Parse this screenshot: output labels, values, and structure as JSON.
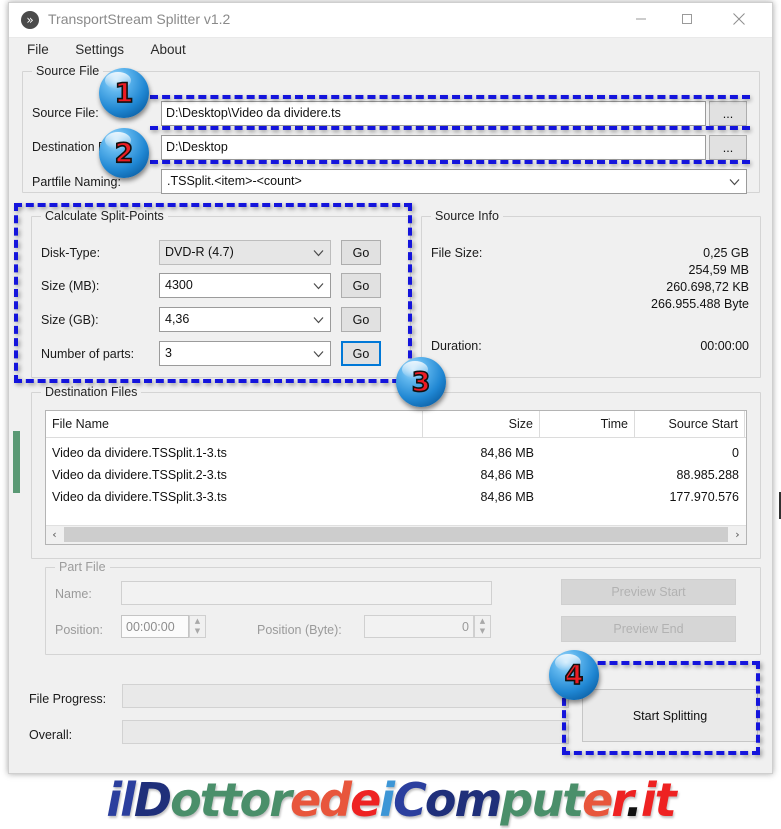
{
  "window": {
    "title": "TransportStream Splitter v1.2",
    "icon": "chevrons-icon",
    "minimize": "minimize-icon",
    "maximize": "maximize-icon",
    "close": "close-icon"
  },
  "menu": {
    "items": [
      "File",
      "Settings",
      "About"
    ]
  },
  "source_file_group": {
    "legend": "Source File",
    "source_file_label": "Source File:",
    "source_file_value": "D:\\Desktop\\Video da dividere.ts",
    "destination_folder_label": "Destination Folder:",
    "destination_folder_value": "D:\\Desktop",
    "partfile_naming_label": "Partfile Naming:",
    "partfile_naming_value": ".TSSplit.<item>-<count>",
    "browse_label": "..."
  },
  "split_points_group": {
    "legend": "Calculate Split-Points",
    "go_label": "Go",
    "rows": [
      {
        "label": "Disk-Type:",
        "value": "DVD-R (4.7)"
      },
      {
        "label": "Size (MB):",
        "value": "4300"
      },
      {
        "label": "Size (GB):",
        "value": "4,36"
      },
      {
        "label": "Number of parts:",
        "value": "3"
      }
    ]
  },
  "source_info_group": {
    "legend": "Source Info",
    "file_size_label": "File Size:",
    "file_size_values": [
      "0,25 GB",
      "254,59 MB",
      "260.698,72 KB",
      "266.955.488 Byte"
    ],
    "duration_label": "Duration:",
    "duration_value": "00:00:00"
  },
  "destination_files_group": {
    "legend": "Destination Files",
    "columns": [
      "File Name",
      "Size",
      "Time",
      "Source Start"
    ],
    "rows": [
      {
        "name": "Video da dividere.TSSplit.1-3.ts",
        "size": "84,86 MB",
        "time": "",
        "source_start": "0"
      },
      {
        "name": "Video da dividere.TSSplit.2-3.ts",
        "size": "84,86 MB",
        "time": "",
        "source_start": "88.985.288"
      },
      {
        "name": "Video da dividere.TSSplit.3-3.ts",
        "size": "84,86 MB",
        "time": "",
        "source_start": "177.970.576"
      }
    ],
    "scroll_left": "‹",
    "scroll_right": "›"
  },
  "part_file_group": {
    "legend": "Part File",
    "name_label": "Name:",
    "name_value": "",
    "position_label": "Position:",
    "position_value": "00:00:00",
    "position_byte_label": "Position (Byte):",
    "position_byte_value": "0",
    "preview_start_label": "Preview Start",
    "preview_end_label": "Preview End"
  },
  "progress": {
    "file_progress_label": "File Progress:",
    "overall_label": "Overall:",
    "start_splitting_label": "Start Splitting"
  },
  "annotations": {
    "badges": [
      "1",
      "2",
      "3",
      "4"
    ],
    "accent_color": "#1414dc",
    "badge_number_color": "#ec1c24"
  },
  "watermark": {
    "segments": [
      {
        "text": "il",
        "color": "#2b3f9e"
      },
      {
        "text": "D",
        "color": "#1f2f7a"
      },
      {
        "text": "ottor",
        "color": "#4a8f6a"
      },
      {
        "text": "ed",
        "color": "#e8563c"
      },
      {
        "text": "e",
        "color": "#ee2222"
      },
      {
        "text": "i",
        "color": "#3d96d6"
      },
      {
        "text": "C",
        "color": "#2b3f9e"
      },
      {
        "text": "om",
        "color": "#1f2f7a"
      },
      {
        "text": "put",
        "color": "#4a8f6a"
      },
      {
        "text": "e",
        "color": "#e8563c"
      },
      {
        "text": "r",
        "color": "#ee2222"
      },
      {
        "text": ".",
        "color": "#111111"
      },
      {
        "text": "it",
        "color": "#ee2222"
      }
    ]
  }
}
